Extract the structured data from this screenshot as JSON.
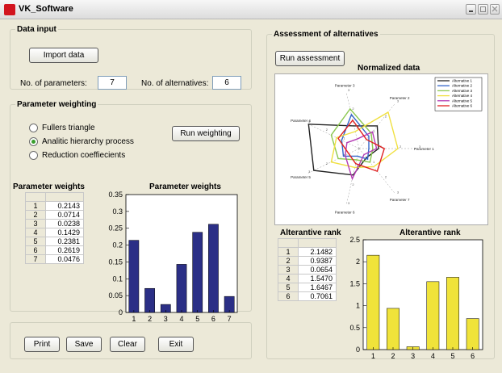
{
  "window": {
    "title": "VK_Software",
    "controls": [
      {
        "name": "minimize-button",
        "icon": "minimize-icon"
      },
      {
        "name": "maximize-button",
        "icon": "maximize-icon"
      },
      {
        "name": "close-button",
        "icon": "close-icon"
      }
    ]
  },
  "data_input": {
    "legend": "Data input",
    "import_label": "Import data",
    "params_label": "No. of parameters:",
    "params_value": "7",
    "alts_label": "No. of alternatives:",
    "alts_value": "6"
  },
  "weighting": {
    "legend": "Parameter weighting",
    "options": [
      {
        "label": "Fullers triangle",
        "selected": false
      },
      {
        "label": "Analitic hierarchy process",
        "selected": true
      },
      {
        "label": "Reduction coeffiecients",
        "selected": false
      }
    ],
    "run_label": "Run weighting",
    "table_title": "Parameter weights",
    "rows": [
      {
        "index": "1",
        "value": "0.2143"
      },
      {
        "index": "2",
        "value": "0.0714"
      },
      {
        "index": "3",
        "value": "0.0238"
      },
      {
        "index": "4",
        "value": "0.1429"
      },
      {
        "index": "5",
        "value": "0.2381"
      },
      {
        "index": "6",
        "value": "0.2619"
      },
      {
        "index": "7",
        "value": "0.0476"
      }
    ]
  },
  "assessment": {
    "legend": "Assessment of alternatives",
    "run_label": "Run assessment",
    "table_title": "Alterantive rank",
    "rows": [
      {
        "index": "1",
        "value": "2.1482"
      },
      {
        "index": "2",
        "value": "0.9387"
      },
      {
        "index": "3",
        "value": "0.0654"
      },
      {
        "index": "4",
        "value": "1.5470"
      },
      {
        "index": "5",
        "value": "1.6467"
      },
      {
        "index": "6",
        "value": "0.7061"
      }
    ]
  },
  "actions": {
    "print": "Print",
    "save": "Save",
    "clear": "Clear",
    "exit": "Exit"
  },
  "colors": {
    "weights_bar": "#2b2f86",
    "rank_bar": "#f0e33a"
  },
  "chart_data": [
    {
      "type": "bar",
      "title": "Parameter weights",
      "categories": [
        "1",
        "2",
        "3",
        "4",
        "5",
        "6",
        "7"
      ],
      "values": [
        0.2143,
        0.0714,
        0.0238,
        0.1429,
        0.2381,
        0.2619,
        0.0476
      ],
      "ylim": [
        0,
        0.35
      ],
      "yticks": [
        "0",
        "0.05",
        "0.1",
        "0.15",
        "0.2",
        "0.25",
        "0.3",
        "0.35"
      ],
      "color": "#2b2f86"
    },
    {
      "type": "bar",
      "title": "Alterantive rank",
      "categories": [
        "1",
        "2",
        "3",
        "4",
        "5",
        "6"
      ],
      "values": [
        2.1482,
        0.9387,
        0.0654,
        1.547,
        1.6467,
        0.7061
      ],
      "ylim": [
        0,
        2.5
      ],
      "yticks": [
        "0",
        "0.5",
        "1",
        "1.5",
        "2",
        "2.5"
      ],
      "color": "#f0e33a"
    },
    {
      "type": "radar",
      "title": "Normalized data",
      "axes": [
        "Parameter 1",
        "Parameter 2",
        "Parameter 3",
        "Parameter 4",
        "Parameter 5",
        "Parameter 6",
        "Parameter 7"
      ],
      "rmax": 3,
      "legend_position": "top-right",
      "series": [
        {
          "name": "Alternative 1",
          "color": "#222222",
          "values": [
            1.0,
            1.5,
            1.2,
            2.9,
            2.6,
            1.4,
            0.6
          ]
        },
        {
          "name": "Alternative 2",
          "color": "#3264c8",
          "values": [
            0.5,
            0.8,
            1.8,
            1.0,
            0.9,
            0.4,
            0.7
          ]
        },
        {
          "name": "Alternative 3",
          "color": "#8cc850",
          "values": [
            0.7,
            1.0,
            2.1,
            1.6,
            1.2,
            0.6,
            0.9
          ]
        },
        {
          "name": "Alternative 4",
          "color": "#f0e040",
          "values": [
            2.0,
            2.4,
            0.9,
            1.3,
            1.6,
            1.0,
            1.2
          ]
        },
        {
          "name": "Alternative 5",
          "color": "#b43cb4",
          "values": [
            0.9,
            1.1,
            0.5,
            0.7,
            0.8,
            1.6,
            0.4
          ]
        },
        {
          "name": "Alternative 6",
          "color": "#e02020",
          "values": [
            1.3,
            0.6,
            1.5,
            1.2,
            0.6,
            0.8,
            1.5
          ]
        }
      ]
    }
  ]
}
